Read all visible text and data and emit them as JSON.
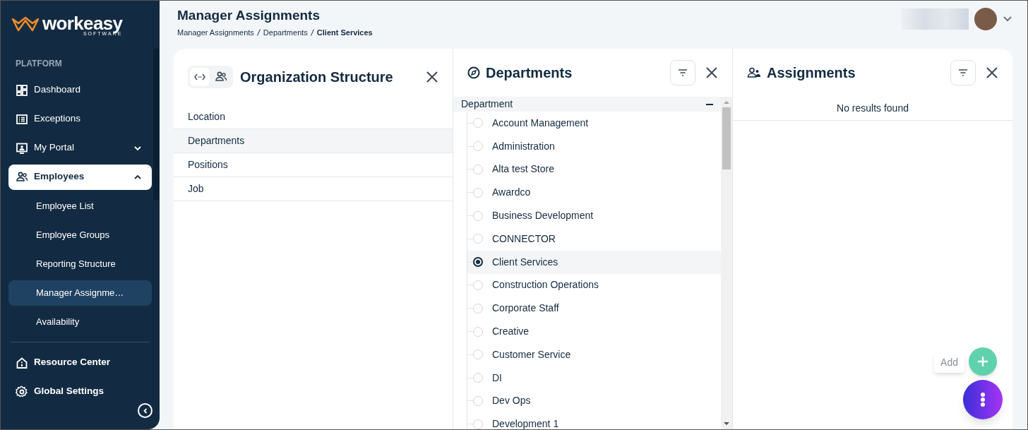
{
  "logo": {
    "name": "workeasy",
    "tagline": "SOFTWARE"
  },
  "sidebar": {
    "section": "PLATFORM",
    "items": [
      {
        "label": "Dashboard",
        "selected": false
      },
      {
        "label": "Exceptions",
        "selected": false
      },
      {
        "label": "My Portal",
        "selected": false,
        "expanded": false
      },
      {
        "label": "Employees",
        "selected": true,
        "expanded": true,
        "children": [
          {
            "label": "Employee List",
            "selected": false
          },
          {
            "label": "Employee Groups",
            "selected": false
          },
          {
            "label": "Reporting Structure",
            "selected": false
          },
          {
            "label": "Manager Assignme…",
            "selected": true
          },
          {
            "label": "Availability",
            "selected": false
          }
        ]
      }
    ],
    "footer_items": [
      {
        "label": "Resource Center"
      },
      {
        "label": "Global Settings"
      }
    ]
  },
  "header": {
    "title": "Manager Assignments",
    "breadcrumb": [
      "Manager Assignments",
      "Departments",
      "Client Services"
    ]
  },
  "org_panel": {
    "title": "Organization Structure",
    "view_toggle": [
      {
        "selected": true
      },
      {
        "selected": false
      }
    ],
    "items": [
      {
        "label": "Location",
        "selected": false
      },
      {
        "label": "Departments",
        "selected": true
      },
      {
        "label": "Positions",
        "selected": false
      },
      {
        "label": "Job",
        "selected": false
      }
    ]
  },
  "departments_panel": {
    "title": "Departments",
    "group": {
      "label": "Department",
      "expanded": true
    },
    "items": [
      {
        "label": "Account Management",
        "selected": false
      },
      {
        "label": "Administration",
        "selected": false
      },
      {
        "label": "Alta test Store",
        "selected": false
      },
      {
        "label": "Awardco",
        "selected": false
      },
      {
        "label": "Business Development",
        "selected": false
      },
      {
        "label": "CONNECTOR",
        "selected": false
      },
      {
        "label": "Client Services",
        "selected": true
      },
      {
        "label": "Construction Operations",
        "selected": false
      },
      {
        "label": "Corporate Staff",
        "selected": false
      },
      {
        "label": "Creative",
        "selected": false
      },
      {
        "label": "Customer Service",
        "selected": false
      },
      {
        "label": "DI",
        "selected": false
      },
      {
        "label": "Dev Ops",
        "selected": false
      },
      {
        "label": "Development 1",
        "selected": false
      }
    ]
  },
  "assignments_panel": {
    "title": "Assignments",
    "empty_message": "No results found"
  },
  "fab": {
    "tooltip": "Add"
  }
}
